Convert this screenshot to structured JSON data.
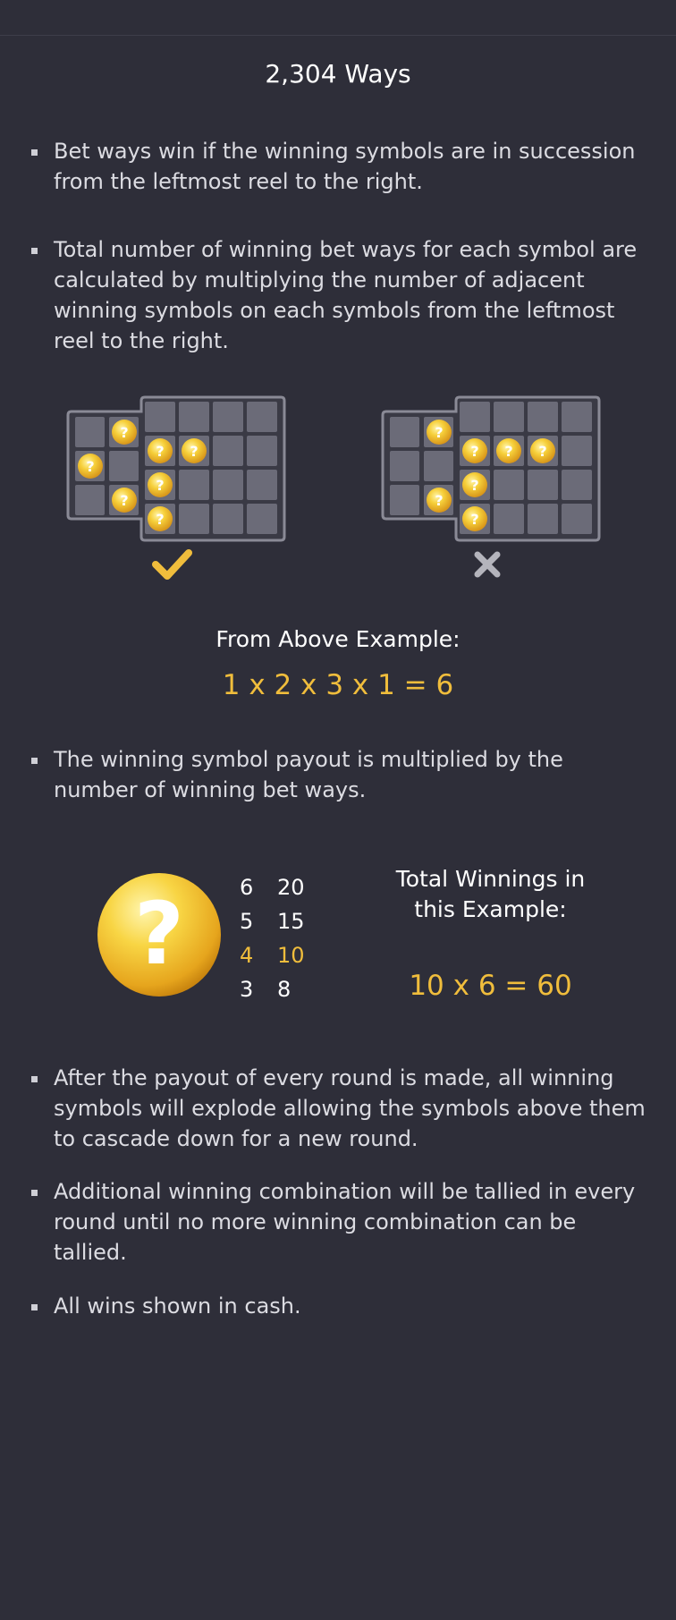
{
  "title": "2,304 Ways",
  "rules": [
    "Bet ways win if the winning symbols are in succession from the leftmost reel to the right.",
    "Total number of winning bet ways for each symbol are calculated by multiplying the number of adjacent winning symbols on each symbols from the leftmost reel to the right.",
    "The winning symbol payout is multiplied by the number of winning bet ways.",
    "After the payout of every round is made, all winning symbols will explode allowing the symbols above them to cascade down for a new round.",
    "Additional winning combination will be tallied in every round until no more winning combination can be tallied.",
    "All wins shown in cash."
  ],
  "examples": {
    "valid": {
      "label": "check-icon"
    },
    "invalid": {
      "label": "cross-icon"
    }
  },
  "example_heading": "From Above Example:",
  "example_formula": "1 x 2 x 3 x 1 = 6",
  "symbol": {
    "icon": "question-coin-icon"
  },
  "paytable": [
    {
      "count": "6",
      "payout": "20",
      "highlight": false
    },
    {
      "count": "5",
      "payout": "15",
      "highlight": false
    },
    {
      "count": "4",
      "payout": "10",
      "highlight": true
    },
    {
      "count": "3",
      "payout": "8",
      "highlight": false
    }
  ],
  "total_label": "Total Winnings in this Example:",
  "total_formula": "10 x 6 = 60",
  "colors": {
    "background": "#2e2e39",
    "accent": "#f0bd3c",
    "cell": "#6b6b78",
    "frame": "#8a8a96"
  }
}
